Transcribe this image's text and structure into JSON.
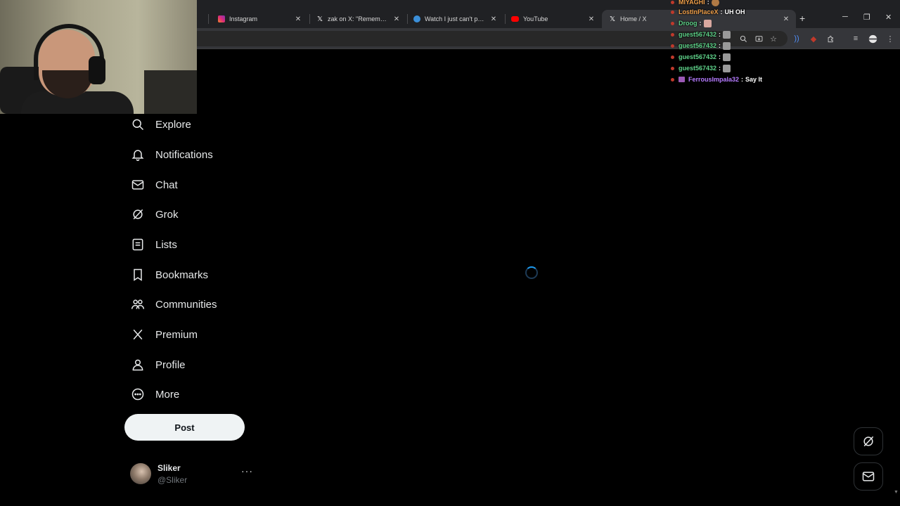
{
  "browser": {
    "tabs": [
      {
        "title": "Instagram",
        "favicon": "instagram-icon"
      },
      {
        "title": "zak on X: \"Remember wh",
        "favicon": "x-logo-icon"
      },
      {
        "title": "Watch I just can't prove it",
        "favicon": "globe-icon"
      },
      {
        "title": "YouTube",
        "favicon": "youtube-icon"
      },
      {
        "title": "Home / X",
        "favicon": "x-logo-icon",
        "active": true
      }
    ],
    "close_glyph": "✕",
    "newtab_glyph": "+",
    "window_controls": {
      "minimize": "─",
      "restore": "❐",
      "close": "✕"
    },
    "toolbar_icons": [
      "zoom-icon",
      "install-icon",
      "bookmark-star-icon",
      "audio-icon",
      "shield-icon",
      "extensions-icon",
      "media-icon",
      "profile-icon",
      "menu-icon"
    ]
  },
  "chat": {
    "messages": [
      {
        "user": "MIYAGHI",
        "color": "orange",
        "text": "",
        "emote": "cookie"
      },
      {
        "user": "LostInPlaceX",
        "color": "orange",
        "text": "UH OH",
        "emote": ""
      },
      {
        "user": "Droog",
        "color": "green",
        "text": "",
        "emote": "hand"
      },
      {
        "user": "guest567432",
        "color": "green",
        "text": "",
        "emote": "face"
      },
      {
        "user": "guest567432",
        "color": "green",
        "text": "",
        "emote": "face"
      },
      {
        "user": "guest567432",
        "color": "green",
        "text": "",
        "emote": "face"
      },
      {
        "user": "guest567432",
        "color": "green",
        "text": "",
        "emote": "face"
      },
      {
        "user": "FerrousImpala32",
        "color": "purple",
        "text": "Say It",
        "emote": ""
      }
    ],
    "separator": ":"
  },
  "nav": {
    "items": [
      {
        "label": "Explore",
        "icon": "search-icon"
      },
      {
        "label": "Notifications",
        "icon": "bell-icon"
      },
      {
        "label": "Chat",
        "icon": "mail-icon"
      },
      {
        "label": "Grok",
        "icon": "grok-icon"
      },
      {
        "label": "Lists",
        "icon": "list-icon"
      },
      {
        "label": "Bookmarks",
        "icon": "bookmark-icon"
      },
      {
        "label": "Communities",
        "icon": "communities-icon"
      },
      {
        "label": "Premium",
        "icon": "x-logo-icon"
      },
      {
        "label": "Profile",
        "icon": "person-icon"
      },
      {
        "label": "More",
        "icon": "more-circle-icon"
      }
    ]
  },
  "post_button": "Post",
  "account": {
    "name": "Sliker",
    "handle": "@Sliker",
    "more": "···"
  },
  "colors": {
    "accent": "#1d9bf0",
    "background": "#000000",
    "text": "#e7e9ea",
    "muted": "#71767b"
  }
}
